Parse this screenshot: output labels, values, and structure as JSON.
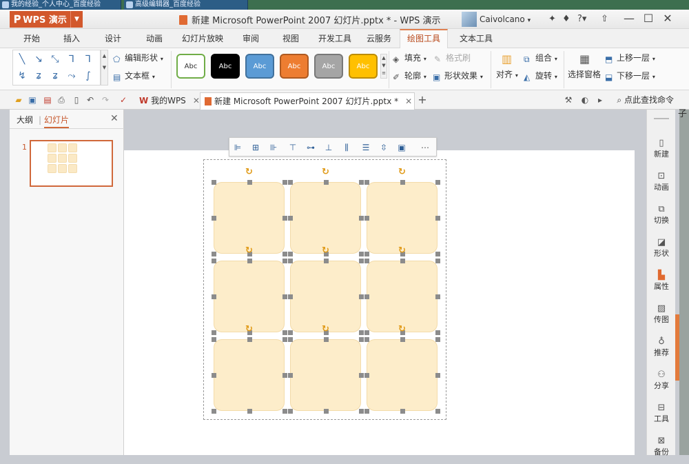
{
  "os_tabs": [
    {
      "label": "我的经验_个人中心_百度经验"
    },
    {
      "label": "高级编辑器_百度经验"
    }
  ],
  "app": {
    "name": "WPS 演示",
    "doc_title": "新建 Microsoft PowerPoint 2007 幻灯片.pptx * - WPS 演示",
    "user": "Caivolcano"
  },
  "ribbon_tabs": [
    "开始",
    "插入",
    "设计",
    "动画",
    "幻灯片放映",
    "审阅",
    "视图",
    "开发工具",
    "云服务",
    "绘图工具",
    "文本工具"
  ],
  "ribbon": {
    "edit_shape": "编辑形状",
    "text_box": "文本框",
    "style_swatches": [
      {
        "label": "Abc",
        "bg": "#ffffff",
        "fg": "#333333",
        "border": "#70ad47"
      },
      {
        "label": "Abc",
        "bg": "#000000",
        "fg": "#ffffff",
        "border": "#000000"
      },
      {
        "label": "Abc",
        "bg": "#5b9bd5",
        "fg": "#ffffff",
        "border": "#41719c"
      },
      {
        "label": "Abc",
        "bg": "#ed7d31",
        "fg": "#ffffff",
        "border": "#ae5a21"
      },
      {
        "label": "Abc",
        "bg": "#a5a5a5",
        "fg": "#ffffff",
        "border": "#787878"
      },
      {
        "label": "Abc",
        "bg": "#ffc000",
        "fg": "#ffffff",
        "border": "#bc8c00"
      }
    ],
    "fill": "填充",
    "format_brush": "格式刷",
    "outline": "轮廓",
    "shape_effect": "形状效果",
    "align": "对齐",
    "group": "组合",
    "rotate": "旋转",
    "selection_pane": "选择窗格",
    "bring_forward": "上移一层",
    "send_backward": "下移一层"
  },
  "doc_tabs": [
    {
      "label": "我的WPS"
    },
    {
      "label": "新建 Microsoft PowerPoint 2007 幻灯片.pptx *"
    }
  ],
  "find_command": "点此查找命令",
  "left_panel": {
    "tab_outline": "大纲",
    "tab_slides": "幻灯片",
    "slide_number": "1"
  },
  "right_sidebar": [
    "新建",
    "动画",
    "切换",
    "形状",
    "属性",
    "传图",
    "推荐",
    "分享",
    "工具",
    "备份"
  ],
  "edge_glyph": "子",
  "colors": {
    "accent": "#d2582c",
    "shape_fill": "#fdedca",
    "handle": "#8c8c8c",
    "rotate_handle": "#e09a18"
  },
  "icons": [
    "wps-logo-icon",
    "minimize-icon",
    "maximize-icon",
    "close-icon",
    "undo-icon",
    "redo-icon",
    "save-icon",
    "open-icon",
    "print-icon",
    "search-icon",
    "add-tab-icon",
    "rotate-handle-icon"
  ]
}
